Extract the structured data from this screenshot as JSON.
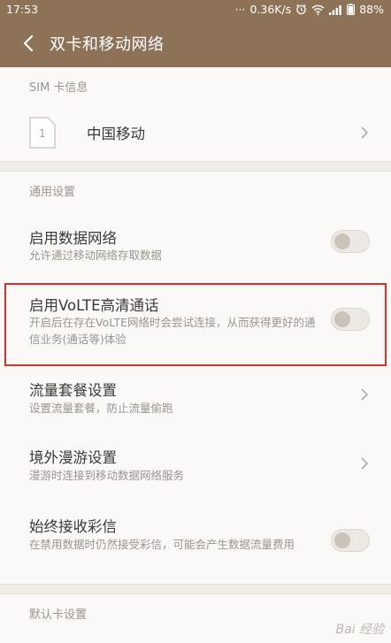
{
  "status": {
    "time": "17:53",
    "dots": "···",
    "speed": "0.36K/s",
    "battery": "88%",
    "icons": [
      "alarm-icon",
      "wifi-icon",
      "signal-icon",
      "battery-icon"
    ]
  },
  "header": {
    "title": "双卡和移动网络"
  },
  "sim_section": {
    "label": "SIM 卡信息",
    "sim_number": "1",
    "carrier": "中国移动"
  },
  "general": {
    "label": "通用设置",
    "items": [
      {
        "title": "启用数据网络",
        "subtitle": "允许通过移动网络存取数据",
        "control": "toggle",
        "on": false
      },
      {
        "title": "启用VoLTE高清通话",
        "subtitle": "开启后在存在VoLTE网络时会尝试连接，从而获得更好的通信业务(通话等)体验",
        "control": "toggle",
        "on": false
      },
      {
        "title": "流量套餐设置",
        "subtitle": "设置流量套餐，防止流量偷跑",
        "control": "chevron"
      },
      {
        "title": "境外漫游设置",
        "subtitle": "漫游时连接到移动数据网络服务",
        "control": "chevron"
      },
      {
        "title": "始终接收彩信",
        "subtitle": "在禁用数据时仍然接受彩信，可能会产生数据流量费用",
        "control": "toggle",
        "on": false
      }
    ]
  },
  "default_section": {
    "label": "默认卡设置"
  },
  "watermark": "Bai 经验",
  "colors": {
    "accent": "#8e7258",
    "highlight": "#e02b2b"
  }
}
